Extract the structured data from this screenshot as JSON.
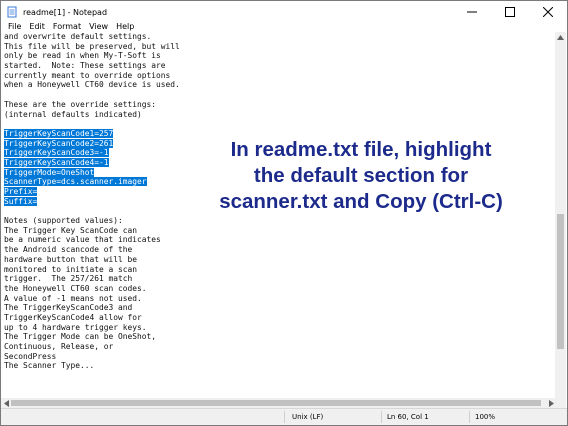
{
  "window": {
    "title": "readme[1] - Notepad"
  },
  "menu": [
    "File",
    "Edit",
    "Format",
    "View",
    "Help"
  ],
  "editor": {
    "lines": [
      {
        "text": "and overwrite default settings.",
        "selected": false
      },
      {
        "text": "This file will be preserved, but will",
        "selected": false
      },
      {
        "text": "only be read in when My-T-Soft is",
        "selected": false
      },
      {
        "text": "started.  Note: These settings are",
        "selected": false
      },
      {
        "text": "currently meant to override options",
        "selected": false
      },
      {
        "text": "when a Honeywell CT60 device is used.",
        "selected": false
      },
      {
        "text": "",
        "selected": false
      },
      {
        "text": "These are the override settings:",
        "selected": false
      },
      {
        "text": "(internal defaults indicated)",
        "selected": false
      },
      {
        "text": "",
        "selected": false
      },
      {
        "text": "TriggerKeyScanCode1=257",
        "selected": true
      },
      {
        "text": "TriggerKeyScanCode2=261",
        "selected": true
      },
      {
        "text": "TriggerKeyScanCode3=-1",
        "selected": true
      },
      {
        "text": "TriggerKeyScanCode4=-1",
        "selected": true
      },
      {
        "text": "TriggerMode=OneShot",
        "selected": true
      },
      {
        "text": "ScannerType=dcs.scanner.imager",
        "selected": true
      },
      {
        "text": "Prefix=",
        "selected": true
      },
      {
        "text": "Suffix=",
        "selected": true
      },
      {
        "text": "",
        "selected": false
      },
      {
        "text": "Notes (supported values):",
        "selected": false
      },
      {
        "text": "The Trigger Key ScanCode can",
        "selected": false
      },
      {
        "text": "be a numeric value that indicates",
        "selected": false
      },
      {
        "text": "the Android scancode of the",
        "selected": false
      },
      {
        "text": "hardware button that will be",
        "selected": false
      },
      {
        "text": "monitored to initiate a scan",
        "selected": false
      },
      {
        "text": "trigger.  The 257/261 match",
        "selected": false
      },
      {
        "text": "the Honeywell CT60 scan codes.",
        "selected": false
      },
      {
        "text": "A value of -1 means not used.",
        "selected": false
      },
      {
        "text": "The TriggerKeyScanCode3 and",
        "selected": false
      },
      {
        "text": "TriggerKeyScanCode4 allow for",
        "selected": false
      },
      {
        "text": "up to 4 hardware trigger keys.",
        "selected": false
      },
      {
        "text": "The Trigger Mode can be OneShot,",
        "selected": false
      },
      {
        "text": "Continuous, Release, or",
        "selected": false
      },
      {
        "text": "SecondPress",
        "selected": false
      },
      {
        "text": "The Scanner Type...",
        "selected": false
      }
    ]
  },
  "annotation": {
    "line1": "In readme.txt file, highlight",
    "line2": "the default section for",
    "line3": "scanner.txt and Copy (Ctrl-C)"
  },
  "status": {
    "line_ending": "Unix (LF)",
    "position": "Ln 60, Col 1",
    "zoom": "100%"
  },
  "colors": {
    "selection": "#0078d7",
    "annotation": "#1c2a8c"
  }
}
